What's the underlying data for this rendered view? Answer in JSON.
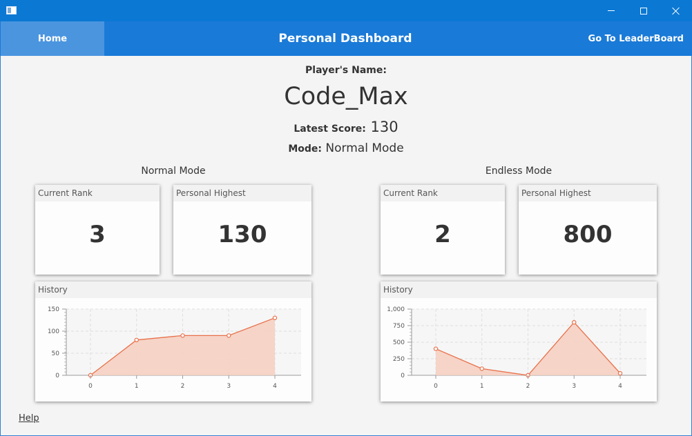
{
  "window": {
    "minimize_glyph": "minimize-icon",
    "maximize_glyph": "maximize-icon",
    "close_glyph": "close-icon"
  },
  "nav": {
    "home": "Home",
    "title": "Personal Dashboard",
    "leaderboard": "Go To LeaderBoard"
  },
  "player": {
    "name_label": "Player's Name:",
    "name": "Code_Max",
    "score_label": "Latest Score:",
    "score": "130",
    "mode_label": "Mode:",
    "mode": "Normal Mode"
  },
  "normal": {
    "title": "Normal Mode",
    "rank_label": "Current Rank",
    "rank": "3",
    "highest_label": "Personal Highest",
    "highest": "130",
    "history_label": "History"
  },
  "endless": {
    "title": "Endless Mode",
    "rank_label": "Current Rank",
    "rank": "2",
    "highest_label": "Personal Highest",
    "highest": "800",
    "history_label": "History"
  },
  "footer": {
    "help": "Help"
  },
  "colors": {
    "accent": "#1a7ad7",
    "series": "#e8704a",
    "area": "#f6d0c2"
  },
  "chart_data": [
    {
      "type": "area",
      "x": [
        0,
        1,
        2,
        3,
        4
      ],
      "values": [
        0,
        80,
        90,
        90,
        130
      ],
      "ylim": [
        0,
        150
      ],
      "yticks": [
        0,
        50,
        100,
        150
      ],
      "ytick_labels": [
        "0",
        "50",
        "100",
        "150"
      ],
      "xtick_labels": [
        "0",
        "1",
        "2",
        "3",
        "4"
      ],
      "grid": true
    },
    {
      "type": "area",
      "x": [
        0,
        1,
        2,
        3,
        4
      ],
      "values": [
        400,
        100,
        0,
        800,
        30
      ],
      "ylim": [
        0,
        1000
      ],
      "yticks": [
        0,
        250,
        500,
        750,
        1000
      ],
      "ytick_labels": [
        "0",
        "250",
        "500",
        "750",
        "1,000"
      ],
      "xtick_labels": [
        "0",
        "1",
        "2",
        "3",
        "4"
      ],
      "grid": true
    }
  ]
}
